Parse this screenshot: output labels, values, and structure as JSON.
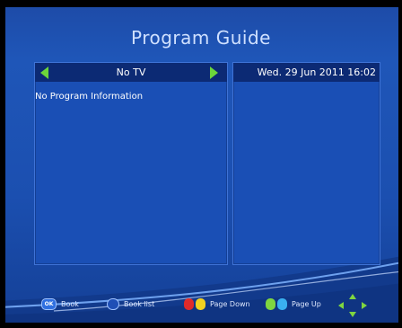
{
  "guide": {
    "title": "Program Guide",
    "channel_name": "No TV",
    "date_time": "Wed.  29 Jun 2011 16:02",
    "no_program_text": "No Program Information"
  },
  "footer": {
    "ok_key": "OK",
    "book_label": "Book",
    "book_list_label": "Book list",
    "page_down_label": "Page Down",
    "page_up_label": "Page Up"
  },
  "colors": {
    "background": "#1d4aa6",
    "header": "#0c2a74",
    "arrow": "#6cd63a",
    "red_key": "#e02a2a",
    "yellow_key": "#f0d020",
    "green_key": "#7fd640",
    "blue_key": "#3ab0f0"
  },
  "icons": {
    "prev_channel": "arrow-left-icon",
    "next_channel": "arrow-right-icon",
    "navigation": "dpad-icon"
  }
}
